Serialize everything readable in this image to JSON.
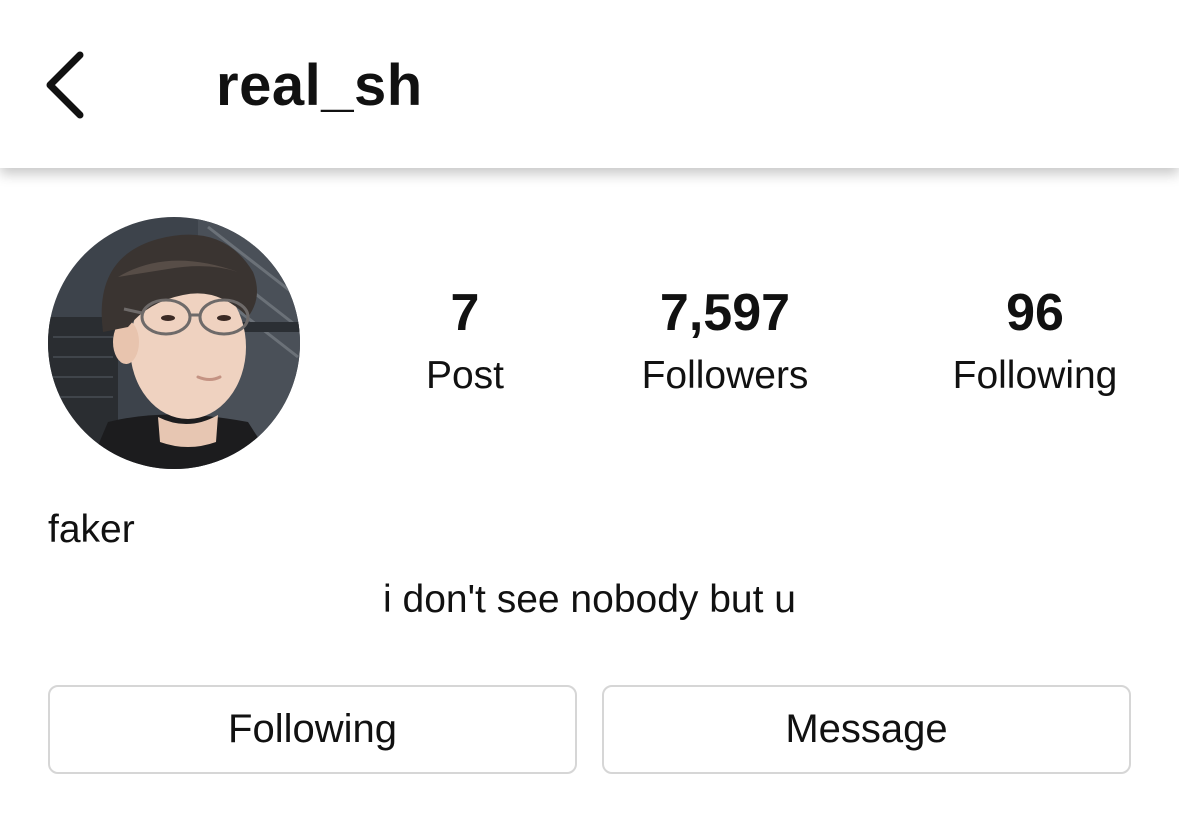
{
  "header": {
    "back_icon": "chevron-left-icon",
    "username": "real_sh"
  },
  "profile": {
    "avatar_icon": "profile-photo",
    "display_name": "faker",
    "bio": "i don't see nobody but u"
  },
  "stats": [
    {
      "value": "7",
      "label": "Post"
    },
    {
      "value": "7,597",
      "label": "Followers"
    },
    {
      "value": "96",
      "label": "Following"
    }
  ],
  "actions": {
    "following_label": "Following",
    "message_label": "Message"
  }
}
